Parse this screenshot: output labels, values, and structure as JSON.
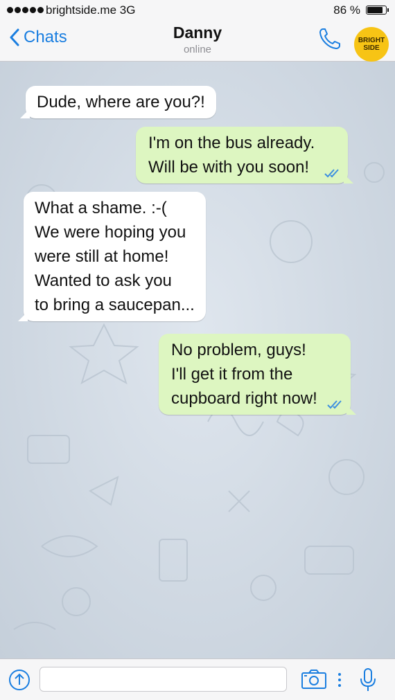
{
  "status_bar": {
    "carrier": "brightside.me 3G",
    "battery_percent": "86 %",
    "battery_level": 0.86
  },
  "header": {
    "back_label": "Chats",
    "contact_name": "Danny",
    "contact_status": "online",
    "logo_line1": "BRIGHT",
    "logo_line2": "SIDE",
    "accent_color": "#1a7ee0",
    "logo_color": "#f7c415"
  },
  "messages": [
    {
      "direction": "in",
      "lines": [
        "Dude, where are you?!"
      ]
    },
    {
      "direction": "out",
      "lines": [
        "I'm on the bus already.",
        "Will be with you soon!"
      ],
      "status": "read"
    },
    {
      "direction": "in",
      "lines": [
        "What a shame. :-(",
        "We were hoping you",
        "were still at home!",
        "Wanted to ask you",
        "to bring a saucepan..."
      ]
    },
    {
      "direction": "out",
      "lines": [
        "No problem, guys!",
        "I'll get it from the",
        "cupboard right now!"
      ],
      "status": "read"
    }
  ],
  "colors": {
    "incoming_bubble": "#ffffff",
    "outgoing_bubble": "#ddf6c1",
    "read_ticks": "#3d8fe0",
    "chat_background": "#d5dde6"
  },
  "input": {
    "placeholder": ""
  },
  "icons": {
    "back": "chevron-left-icon",
    "call": "phone-icon",
    "attach": "upload-arrow-icon",
    "camera": "camera-icon",
    "more": "vertical-dots-icon",
    "mic": "microphone-icon"
  }
}
